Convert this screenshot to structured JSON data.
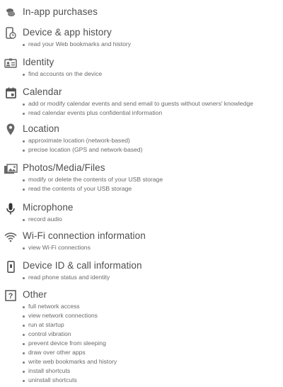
{
  "permissions": [
    {
      "icon": "coins-icon",
      "title": "In-app purchases",
      "items": []
    },
    {
      "icon": "device-history-icon",
      "title": "Device & app history",
      "items": [
        "read your Web bookmarks and history"
      ]
    },
    {
      "icon": "identity-card-icon",
      "title": "Identity",
      "items": [
        "find accounts on the device"
      ]
    },
    {
      "icon": "calendar-icon",
      "title": "Calendar",
      "items": [
        "add or modify calendar events and send email to guests without owners' knowledge",
        "read calendar events plus confidential information"
      ]
    },
    {
      "icon": "location-pin-icon",
      "title": "Location",
      "items": [
        "approximate location (network-based)",
        "precise location (GPS and network-based)"
      ]
    },
    {
      "icon": "photos-icon",
      "title": "Photos/Media/Files",
      "items": [
        "modify or delete the contents of your USB storage",
        "read the contents of your USB storage"
      ]
    },
    {
      "icon": "microphone-icon",
      "title": "Microphone",
      "items": [
        "record audio"
      ]
    },
    {
      "icon": "wifi-info-icon",
      "title": "Wi-Fi connection information",
      "items": [
        "view Wi-Fi connections"
      ]
    },
    {
      "icon": "phone-device-icon",
      "title": "Device ID & call information",
      "items": [
        "read phone status and identity"
      ]
    },
    {
      "icon": "question-box-icon",
      "title": "Other",
      "items": [
        "full network access",
        "view network connections",
        "run at startup",
        "control vibration",
        "prevent device from sleeping",
        "draw over other apps",
        "write web bookmarks and history",
        "install shortcuts",
        "uninstall shortcuts"
      ]
    }
  ]
}
